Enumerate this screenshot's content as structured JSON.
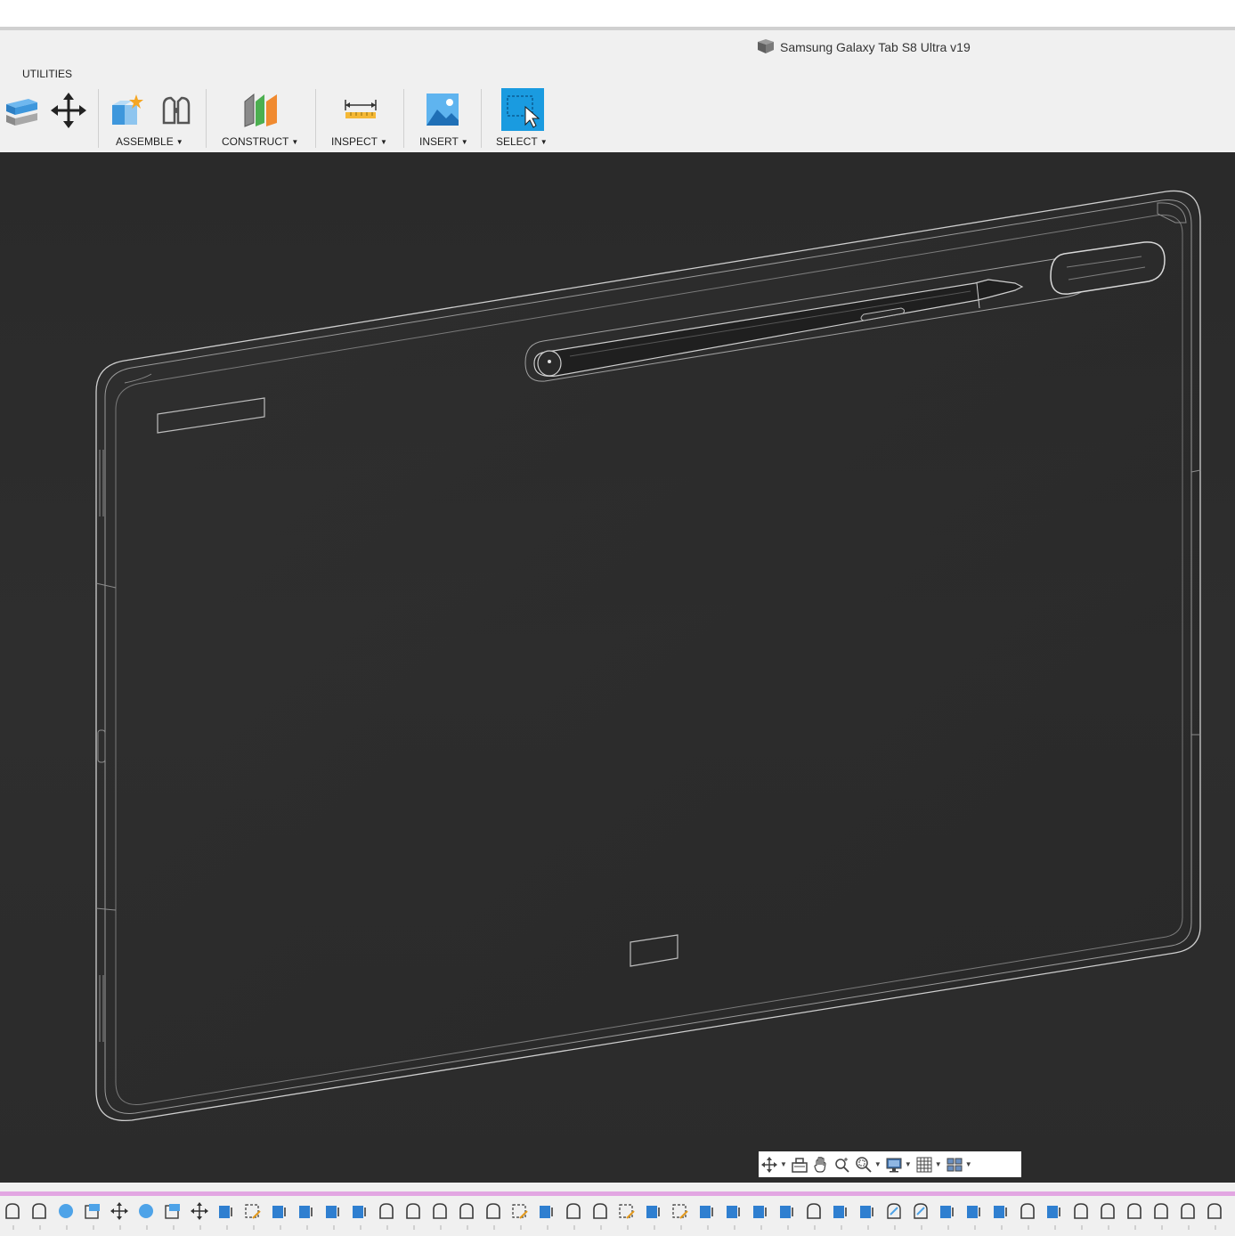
{
  "document": {
    "title": "Samsung Galaxy Tab S8 Ultra v19",
    "icon": "component-box-icon"
  },
  "toolbar": {
    "tab": "UTILITIES",
    "groups": [
      {
        "label": "ASSEMBLE",
        "has_menu": true
      },
      {
        "label": "CONSTRUCT",
        "has_menu": true
      },
      {
        "label": "INSPECT",
        "has_menu": true
      },
      {
        "label": "INSERT",
        "has_menu": true
      },
      {
        "label": "SELECT",
        "has_menu": true,
        "active": true
      }
    ],
    "tools": [
      "make-icon",
      "move-copy-icon",
      "new-component-icon",
      "joint-icon",
      "offset-plane-icon",
      "measure-icon",
      "insert-image-icon",
      "select-icon"
    ]
  },
  "viewport": {
    "background": "#2d2d2d",
    "model": "tablet-with-stylus-wireframe"
  },
  "navigation_bar": {
    "items": [
      "orbit-icon",
      "look-at-icon",
      "pan-icon",
      "zoom-icon",
      "fit-icon",
      "display-settings-icon",
      "grid-icon",
      "viewports-icon"
    ]
  },
  "timeline": {
    "accent": "#e2a6e2",
    "items": [
      "extrude",
      "extrude",
      "sphere",
      "box",
      "move",
      "sphere",
      "box",
      "move",
      "fillet",
      "sketch",
      "fillet",
      "fillet",
      "fillet",
      "fillet",
      "extrude",
      "extrude",
      "extrude",
      "extrude",
      "extrude",
      "sketch",
      "fillet",
      "extrude",
      "extrude",
      "sketch",
      "fillet",
      "sketch",
      "fillet",
      "fillet",
      "fillet",
      "fillet",
      "extrude",
      "fillet",
      "fillet",
      "chamfer",
      "chamfer",
      "fillet",
      "fillet",
      "fillet",
      "extrude",
      "fillet",
      "extrude",
      "extrude",
      "extrude",
      "extrude",
      "extrude",
      "extrude"
    ]
  },
  "colors": {
    "accent_blue": "#1a9be0",
    "toolbar_bg": "#f0f0f0",
    "viewport_bg": "#2d2d2d"
  }
}
